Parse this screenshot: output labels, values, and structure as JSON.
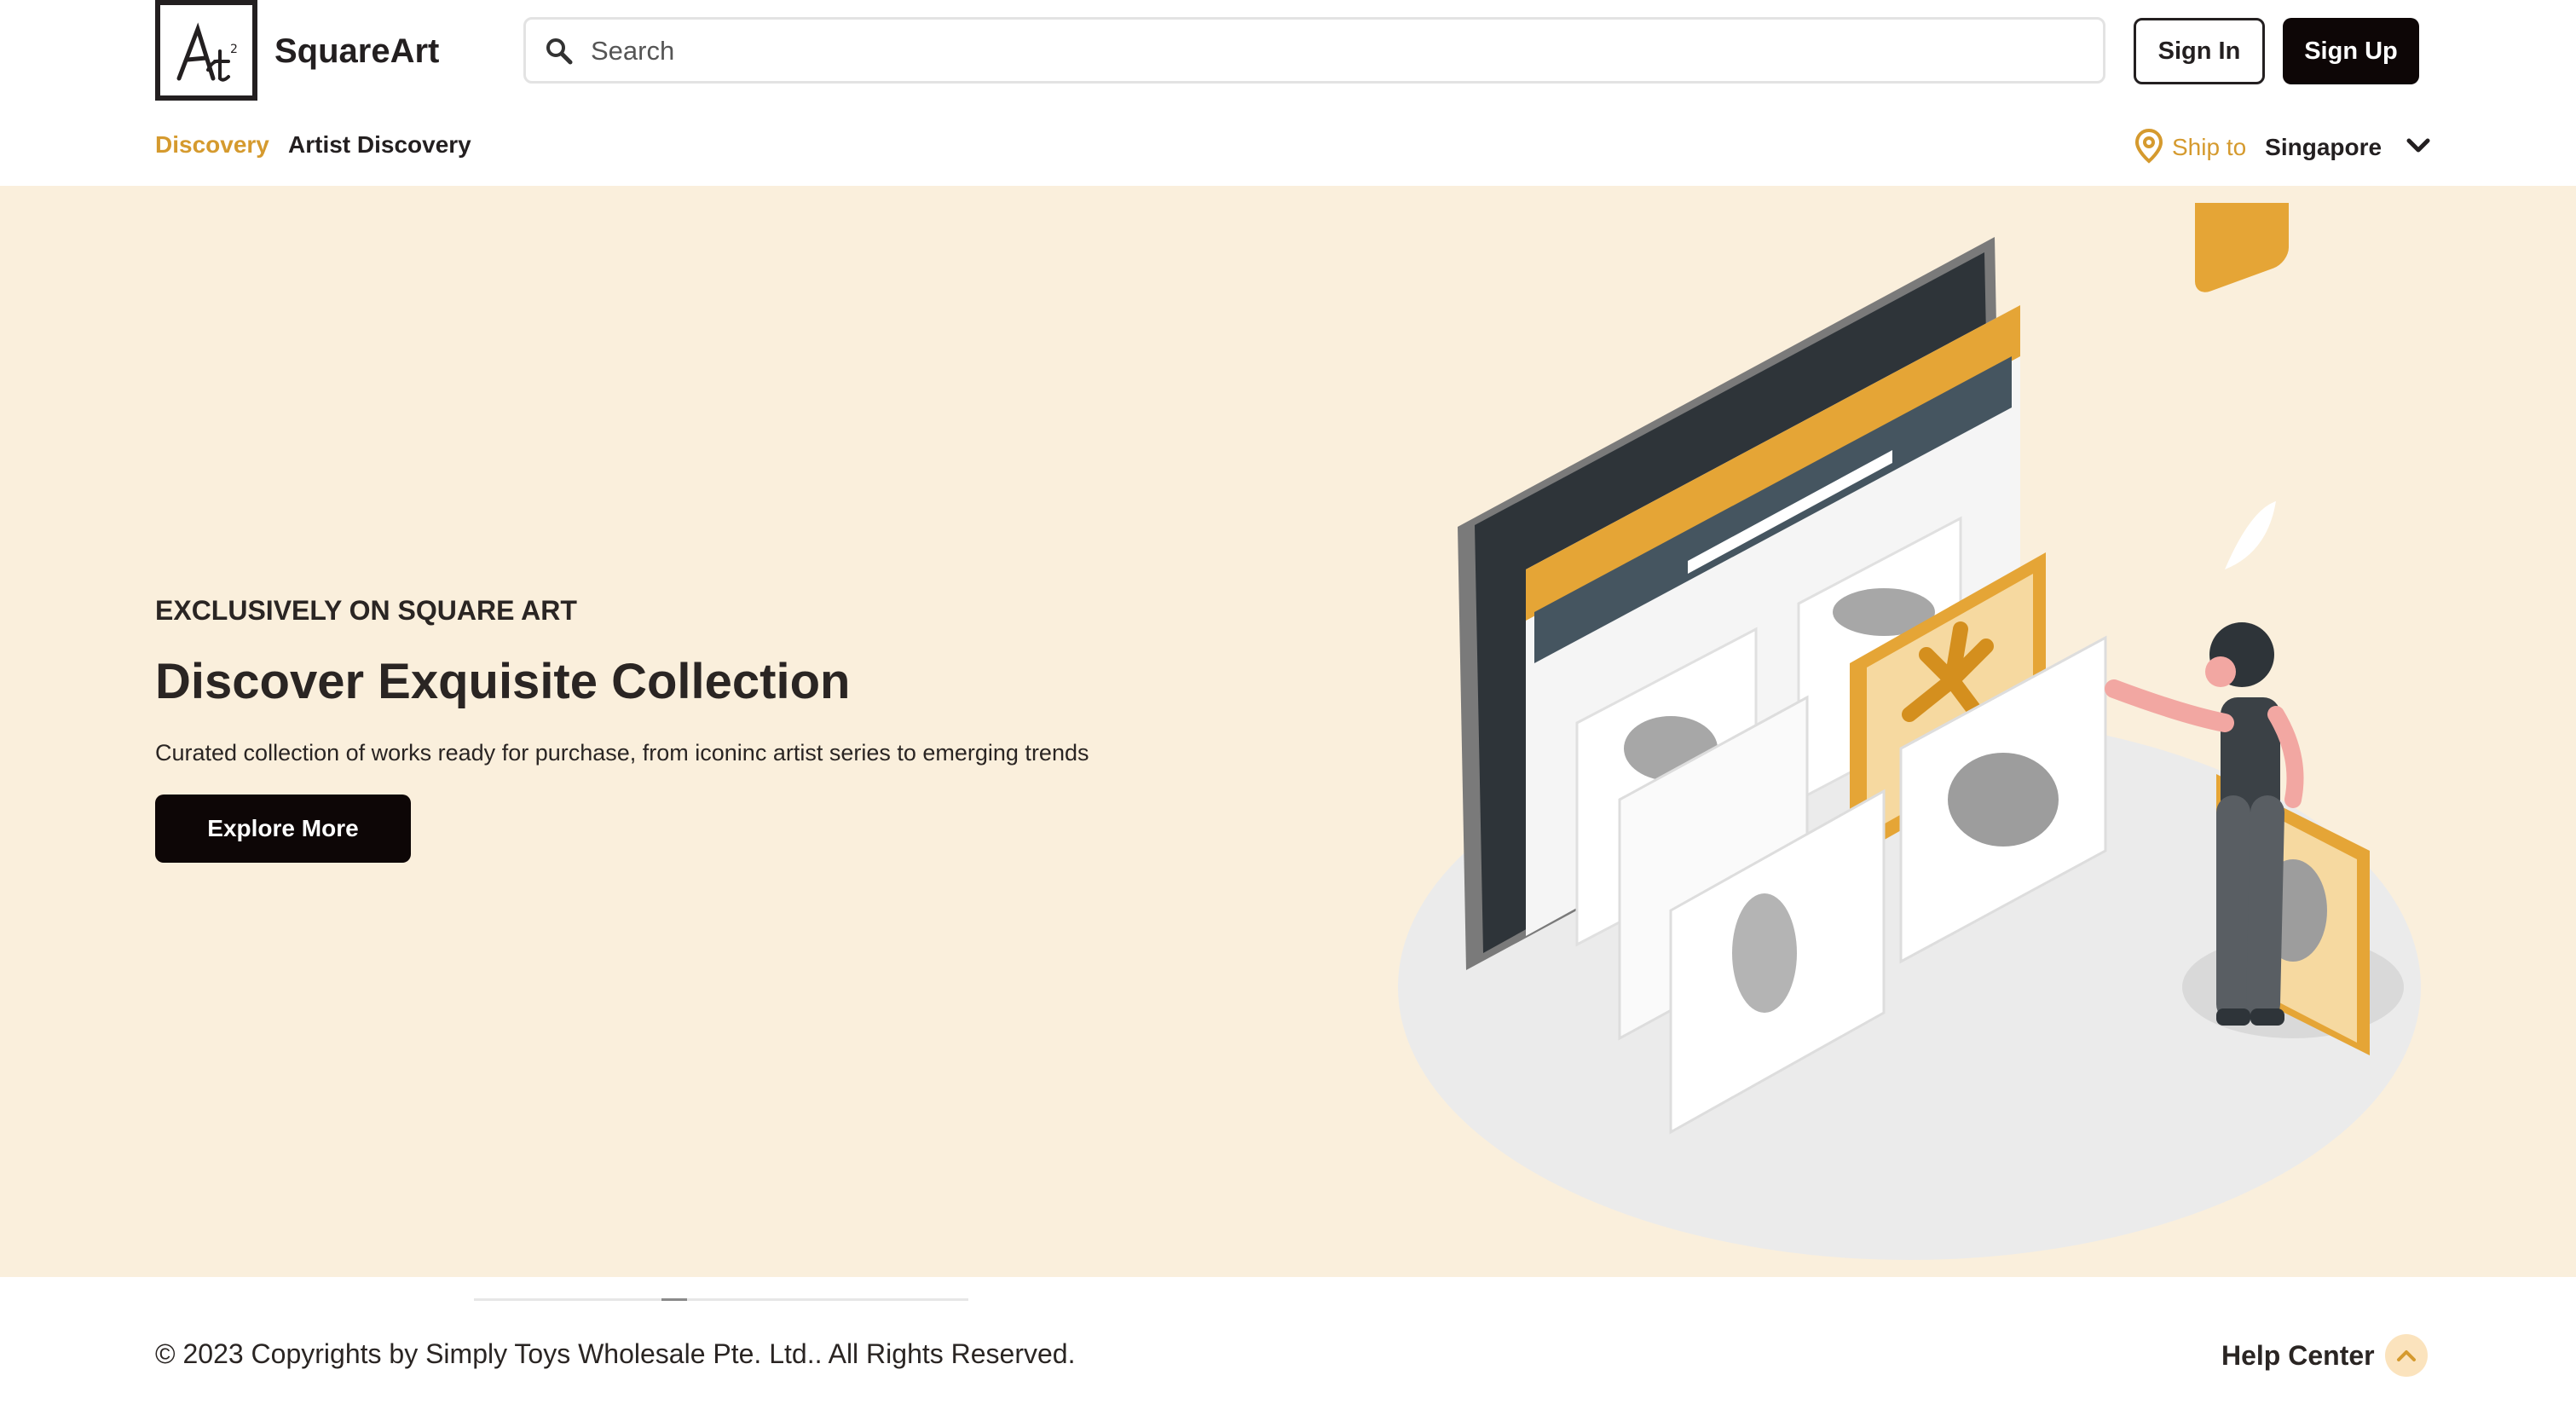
{
  "header": {
    "brand_name": "SquareArt",
    "logo_text": "Art²",
    "search_placeholder": "Search",
    "sign_in_label": "Sign In",
    "sign_up_label": "Sign Up"
  },
  "nav": {
    "items": [
      {
        "label": "Discovery",
        "active": true
      },
      {
        "label": "Artist Discovery",
        "active": false
      }
    ],
    "ship_to_label": "Ship to",
    "ship_country": "Singapore"
  },
  "hero": {
    "eyebrow": "EXCLUSIVELY ON SQUARE ART",
    "title": "Discover Exquisite Collection",
    "description": "Curated collection of works ready for purchase, from iconinc artist series to emerging trends",
    "cta_label": "Explore More"
  },
  "footer": {
    "copyright": "© 2023 Copyrights by Simply Toys Wholesale Pte. Ltd.. All Rights Reserved.",
    "help_label": "Help Center"
  },
  "colors": {
    "accent": "#d59a2e",
    "hero_bg": "#faefdc",
    "button_dark": "#0d0606",
    "text_dark": "#231f20"
  },
  "icons": [
    "search-icon",
    "location-pin-icon",
    "chevron-down-icon",
    "chevron-up-icon"
  ]
}
